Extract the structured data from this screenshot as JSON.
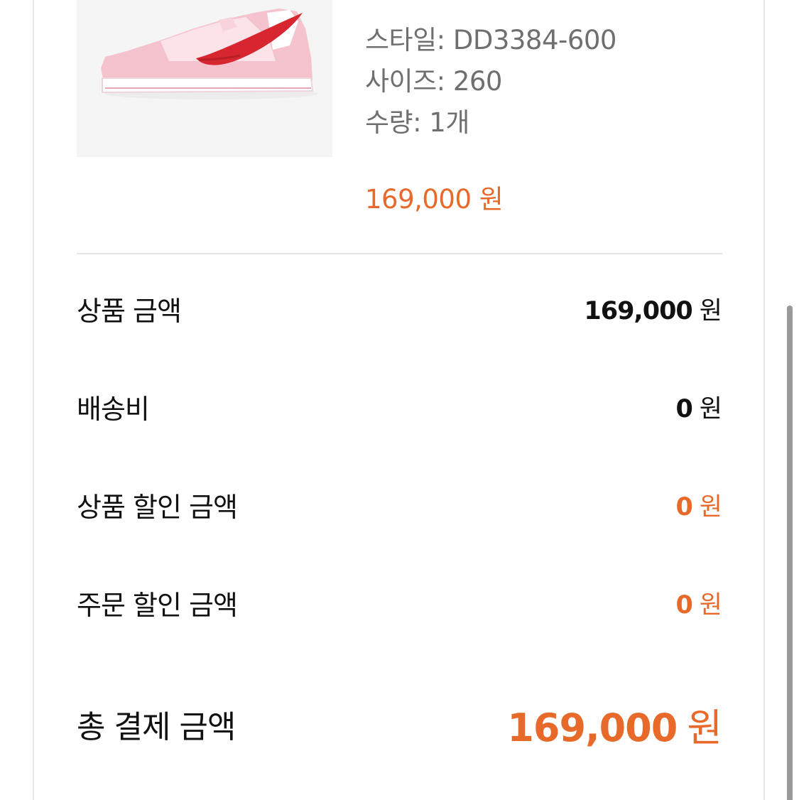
{
  "product": {
    "image_icon": "sneaker-image",
    "style": "스타일: DD3384-600",
    "size": "사이즈: 260",
    "quantity": "수량: 1개",
    "price": "169,000 원"
  },
  "summary": {
    "subtotal": {
      "label": "상품 금액",
      "amount": "169,000",
      "unit": "원"
    },
    "shipping": {
      "label": "배송비",
      "amount": "0",
      "unit": "원"
    },
    "item_discount": {
      "label": "상품 할인 금액",
      "amount": "0",
      "unit": "원"
    },
    "order_discount": {
      "label": "주문 할인 금액",
      "amount": "0",
      "unit": "원"
    },
    "total": {
      "label": "총 결제 금액",
      "amount": "169,000",
      "unit": "원"
    }
  },
  "colors": {
    "accent": "#e86a2a",
    "text": "#111111",
    "muted": "#6f6f6f",
    "divider": "#e6e6e6"
  }
}
